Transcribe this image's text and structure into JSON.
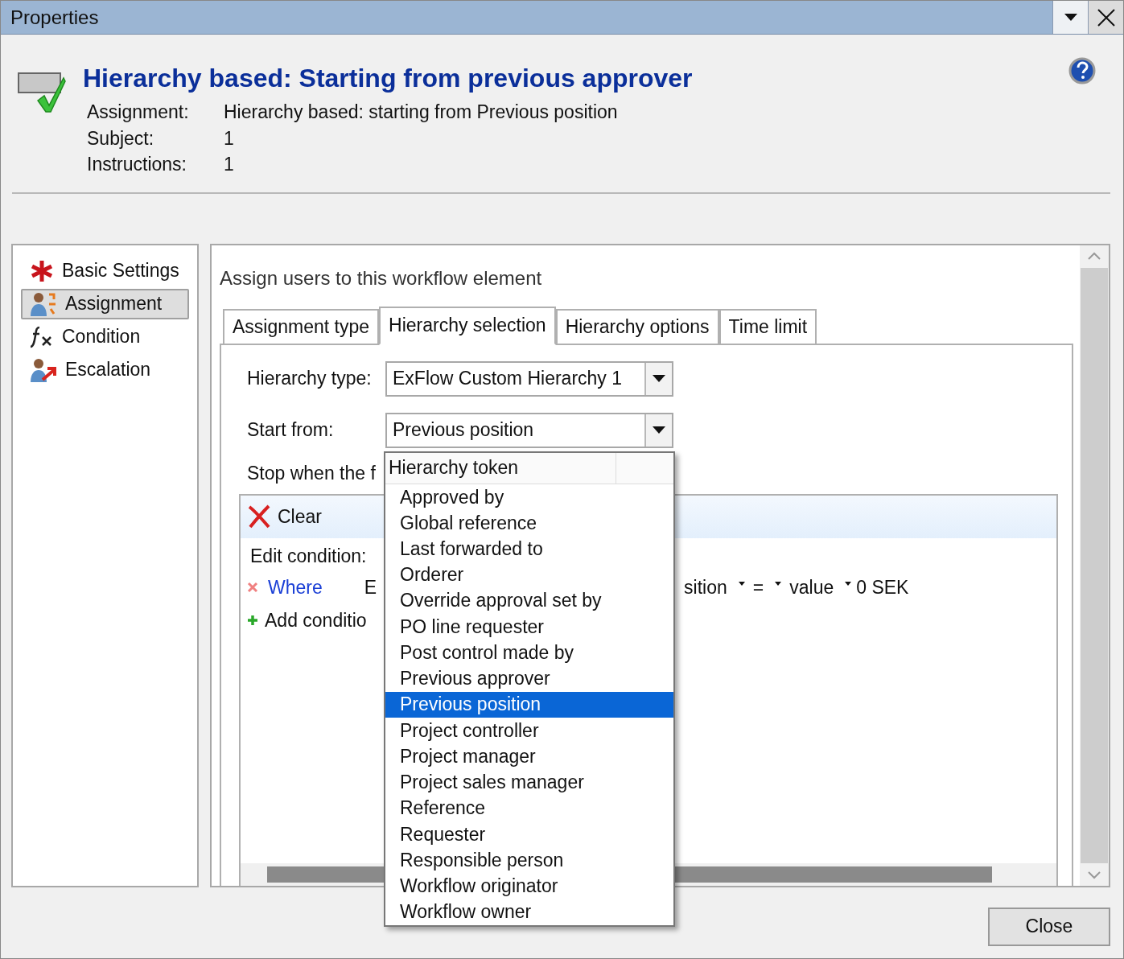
{
  "window": {
    "title": "Properties"
  },
  "header": {
    "title": "Hierarchy based: Starting from previous approver",
    "fields": [
      {
        "label": "Assignment:",
        "value": "Hierarchy based: starting from Previous position"
      },
      {
        "label": "Subject:",
        "value": "1"
      },
      {
        "label": "Instructions:",
        "value": "1"
      }
    ]
  },
  "sidebar": {
    "items": [
      {
        "label": "Basic Settings",
        "kind": "asterisk",
        "selected": false
      },
      {
        "label": "Assignment",
        "kind": "users",
        "selected": true
      },
      {
        "label": "Condition",
        "kind": "formula",
        "selected": false
      },
      {
        "label": "Escalation",
        "kind": "escalate",
        "selected": false
      }
    ]
  },
  "main": {
    "heading": "Assign users to this workflow element",
    "tabs": [
      {
        "label": "Assignment type",
        "selected": false
      },
      {
        "label": "Hierarchy selection",
        "selected": true
      },
      {
        "label": "Hierarchy options",
        "selected": false
      },
      {
        "label": "Time limit",
        "selected": false
      }
    ],
    "hierarchy_type": {
      "label": "Hierarchy type:",
      "value": "ExFlow Custom Hierarchy 1"
    },
    "start_from": {
      "label": "Start from:",
      "value": "Previous position"
    },
    "stop_label": "Stop when the f",
    "condition": {
      "clear": "Clear",
      "edit_label": "Edit condition:",
      "where": "Where",
      "field": "E",
      "field_end": "sition",
      "operator": "=",
      "column_3": "value",
      "column_4": "0 SEK",
      "add": "Add conditio"
    }
  },
  "dropdown": {
    "header": "Hierarchy token",
    "items": [
      {
        "label": "Approved by",
        "selected": false
      },
      {
        "label": "Global reference",
        "selected": false
      },
      {
        "label": "Last forwarded to",
        "selected": false
      },
      {
        "label": "Orderer",
        "selected": false
      },
      {
        "label": "Override approval set by",
        "selected": false
      },
      {
        "label": "PO line requester",
        "selected": false
      },
      {
        "label": "Post control made by",
        "selected": false
      },
      {
        "label": "Previous approver",
        "selected": false
      },
      {
        "label": "Previous position",
        "selected": true
      },
      {
        "label": "Project controller",
        "selected": false
      },
      {
        "label": "Project manager",
        "selected": false
      },
      {
        "label": "Project sales manager",
        "selected": false
      },
      {
        "label": "Reference",
        "selected": false
      },
      {
        "label": "Requester",
        "selected": false
      },
      {
        "label": "Responsible person",
        "selected": false
      },
      {
        "label": "Workflow originator",
        "selected": false
      },
      {
        "label": "Workflow owner",
        "selected": false
      }
    ]
  },
  "buttons": {
    "close": "Close"
  }
}
